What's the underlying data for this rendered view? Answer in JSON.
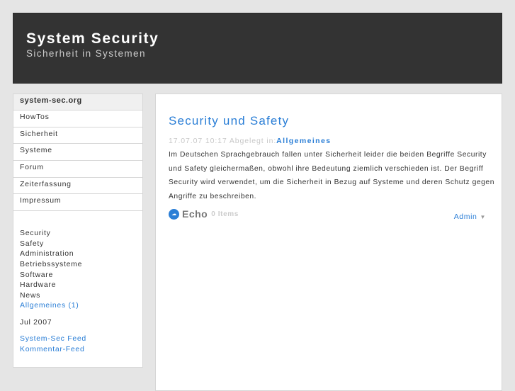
{
  "header": {
    "title": "System Security",
    "subtitle": "Sicherheit in Systemen"
  },
  "sidebar": {
    "title": "system-sec.org",
    "nav": [
      "HowTos",
      "Sicherheit",
      "Systeme",
      "Forum",
      "Zeiterfassung",
      "Impressum"
    ],
    "categories": [
      "Security",
      "Safety",
      "Administration",
      "Betriebssysteme",
      "Software",
      "Hardware",
      "News"
    ],
    "active_category": "Allgemeines (1)",
    "archive": "Jul 2007",
    "feeds": [
      "System-Sec Feed",
      "Kommentar-Feed"
    ]
  },
  "post": {
    "title": "Security und Safety",
    "meta": "17.07.07 10:17 Abgelegt in:",
    "category": "Allgemeines",
    "body": "Im Deutschen Sprachgebrauch fallen unter Sicherheit leider die beiden Begriffe Security und Safety gleichermaßen, obwohl ihre Bedeutung ziemlich verschieden ist. Der Begriff Security wird verwendet, um die Sicherheit in Bezug auf Systeme und deren Schutz gegen Angriffe zu beschreiben.",
    "echo_label": "Echo",
    "echo_count": "0 Items",
    "admin": "Admin"
  },
  "colors": {
    "accent": "#2a7ed6",
    "header_bg": "#333333"
  }
}
